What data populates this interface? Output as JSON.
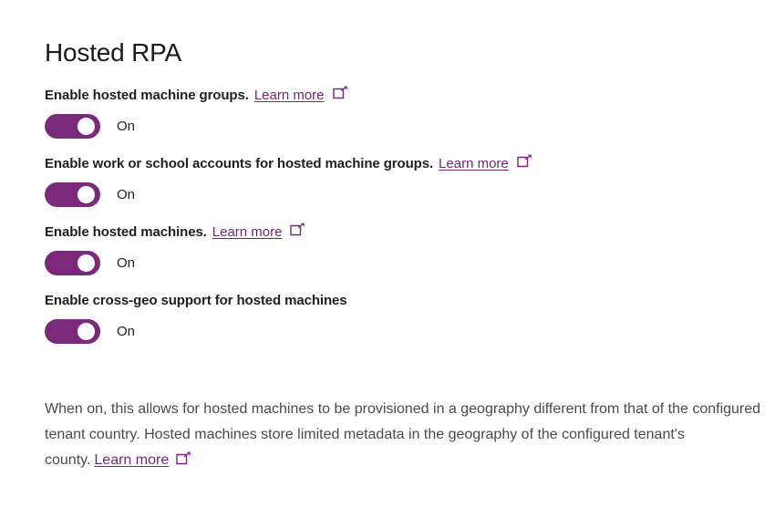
{
  "page": {
    "title": "Hosted RPA",
    "accent_color": "#7b297b",
    "link_color": "#742774",
    "text_color": "#201f1e",
    "description_text_color": "#4a4a4a",
    "background_color": "#ffffff"
  },
  "settings": [
    {
      "label": "Enable hosted machine groups.",
      "learn_more_label": "Learn more",
      "has_learn_more": true,
      "external_link_icon": "external-link-icon",
      "toggle_state": "On",
      "toggle_on": true
    },
    {
      "label": "Enable work or school accounts for hosted machine groups.",
      "learn_more_label": "Learn more",
      "has_learn_more": true,
      "external_link_icon": "external-link-icon",
      "toggle_state": "On",
      "toggle_on": true
    },
    {
      "label": "Enable hosted machines.",
      "learn_more_label": "Learn more",
      "has_learn_more": true,
      "external_link_icon": "external-link-icon",
      "toggle_state": "On",
      "toggle_on": true
    },
    {
      "label": "Enable cross-geo support for hosted machines",
      "learn_more_label": "",
      "has_learn_more": false,
      "external_link_icon": "",
      "toggle_state": "On",
      "toggle_on": true
    }
  ],
  "description": {
    "text": "When on, this allows for hosted machines to be provisioned in a geography different from that of the configured tenant country. Hosted machines store limited metadata in the geography of the configured tenant's county.",
    "learn_more_label": "Learn more",
    "external_link_icon": "external-link-icon"
  }
}
